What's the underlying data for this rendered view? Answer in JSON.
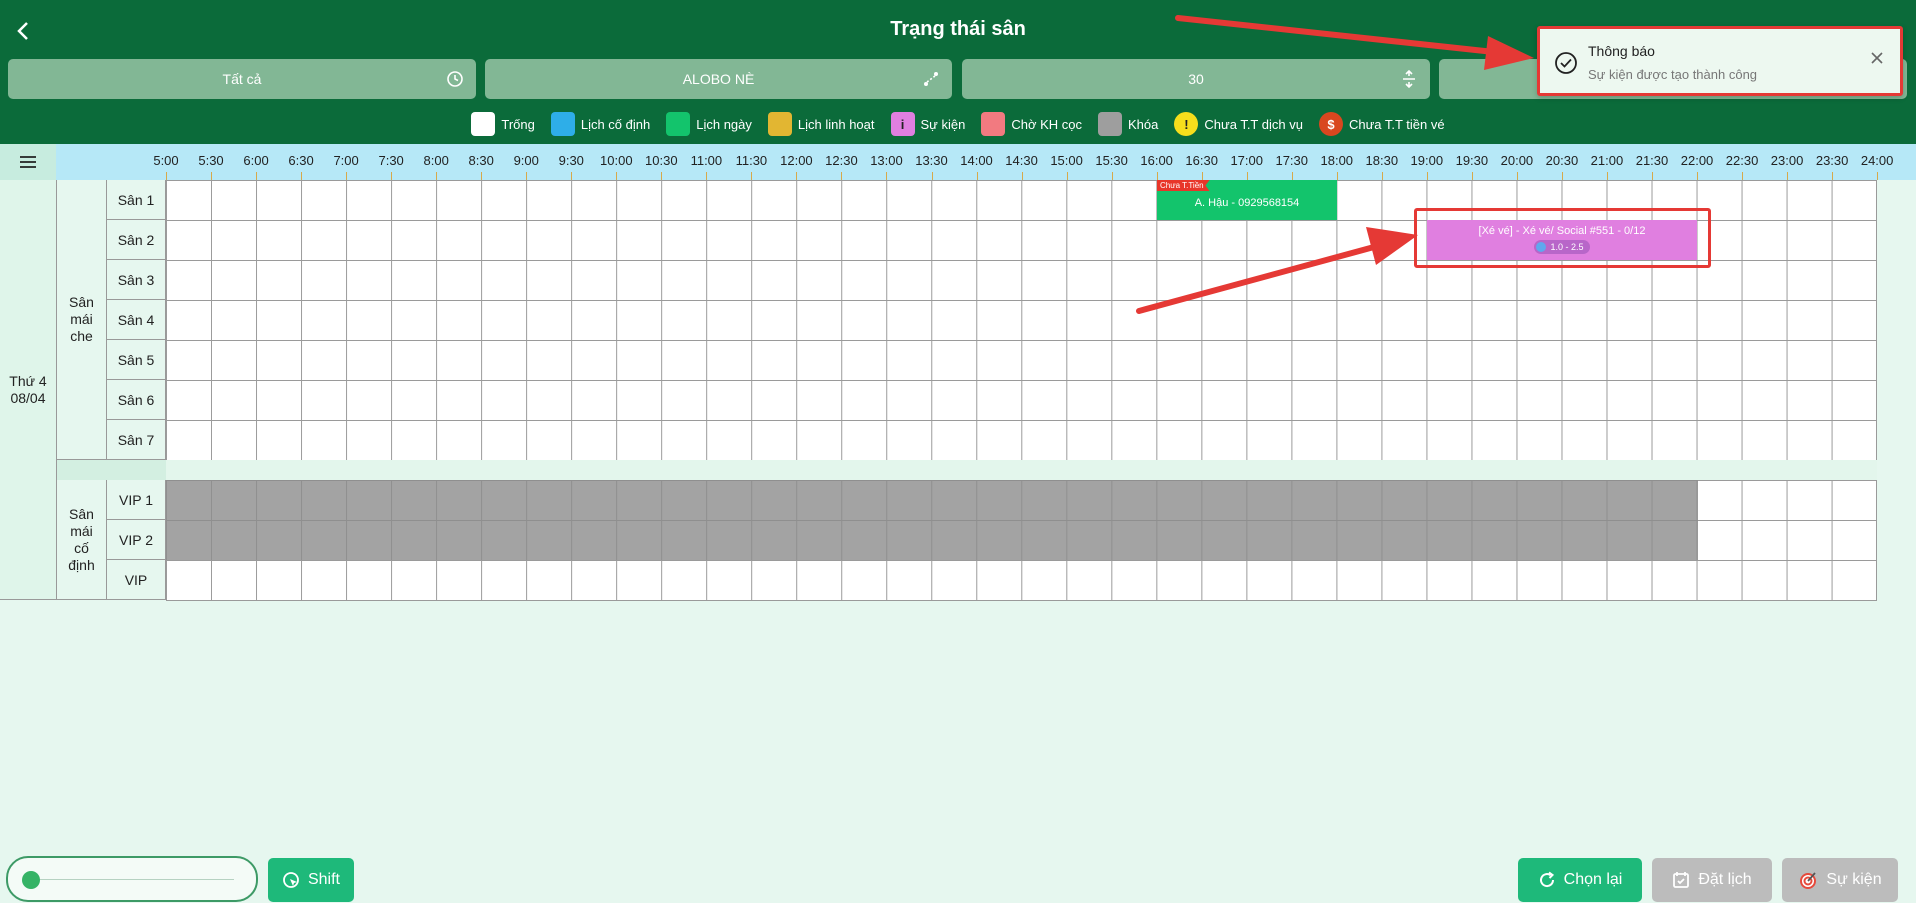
{
  "header": {
    "title": "Trạng thái sân",
    "filters": [
      {
        "label": "Tất cả",
        "icon": "clock-icon"
      },
      {
        "label": "ALOBO NÈ",
        "icon": "map-route-icon"
      },
      {
        "label": "30",
        "icon": "vertical-resize-icon"
      }
    ]
  },
  "legend": [
    {
      "label": "Trống",
      "color": "#ffffff"
    },
    {
      "label": "Lịch cố định",
      "color": "#2eaee8"
    },
    {
      "label": "Lịch ngày",
      "color": "#13c46c"
    },
    {
      "label": "Lịch linh hoạt",
      "color": "#e2b632"
    },
    {
      "label": "Sự kiện",
      "color": "#e07fe0",
      "glyph": "i"
    },
    {
      "label": "Chờ KH cọc",
      "color": "#f27a80"
    },
    {
      "label": "Khóa",
      "color": "#9e9e9e"
    },
    {
      "label": "Chưa T.T dịch vụ",
      "color": "#f6de1c",
      "glyph": "!"
    },
    {
      "label": "Chưa T.T tiền vé",
      "color": "#d9471f",
      "glyph": "$"
    }
  ],
  "times": [
    "5:00",
    "5:30",
    "6:00",
    "6:30",
    "7:00",
    "7:30",
    "8:00",
    "8:30",
    "9:00",
    "9:30",
    "10:00",
    "10:30",
    "11:00",
    "11:30",
    "12:00",
    "12:30",
    "13:00",
    "13:30",
    "14:00",
    "14:30",
    "15:00",
    "15:30",
    "16:00",
    "16:30",
    "17:00",
    "17:30",
    "18:00",
    "18:30",
    "19:00",
    "19:30",
    "20:00",
    "20:30",
    "21:00",
    "21:30",
    "22:00",
    "22:30",
    "23:00",
    "23:30",
    "24:00"
  ],
  "date": {
    "line1": "Thứ 4",
    "line2": "08/04"
  },
  "groups": [
    {
      "name": "Sân mái che",
      "courts": [
        "Sân 1",
        "Sân 2",
        "Sân 3",
        "Sân 4",
        "Sân 5",
        "Sân 6",
        "Sân 7"
      ]
    },
    {
      "name": "Sân mái cố định",
      "courts": [
        "VIP 1",
        "VIP 2",
        "VIP"
      ]
    }
  ],
  "bookings": {
    "daily": {
      "court": "Sân 1",
      "start": "16:00",
      "end": "18:00",
      "tag": "Chưa T.Tiền",
      "text": "A. Hậu - 0929568154"
    },
    "event": {
      "court": "Sân 2",
      "start": "19:00",
      "end": "22:00",
      "title": "[Xé vé] - Xé vé/ Social #551 - 0/12",
      "level": "1.0 - 2.5"
    },
    "locked": {
      "courts": [
        "VIP 1",
        "VIP 2"
      ],
      "start": "5:00",
      "end": "22:00"
    }
  },
  "toast": {
    "title": "Thông báo",
    "message": "Sự kiện được tạo thành công"
  },
  "bottom": {
    "shift_label": "Shift",
    "reload_label": "Chọn lại",
    "book_label": "Đặt lịch",
    "event_label": "Sự kiện",
    "slider_value": 0
  }
}
